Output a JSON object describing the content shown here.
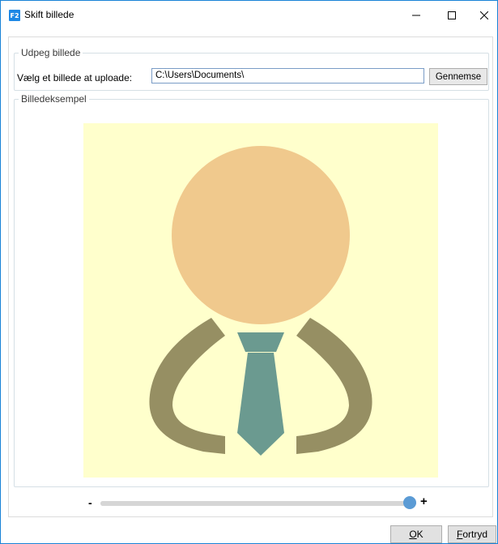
{
  "window": {
    "app_icon_text": "F2",
    "title": "Skift billede"
  },
  "select_group": {
    "legend": "Udpeg billede",
    "upload_label": "Vælg et billede at uploade:",
    "path_value": "C:\\Users\\Documents\\",
    "browse_label": "Gennemse"
  },
  "preview_group": {
    "legend": "Billedeksempel",
    "image_icon": "person-with-tie-avatar",
    "colors": {
      "background": "#ffffcc",
      "head": "#f0c98d",
      "body": "#968f63",
      "tie": "#6b9a90"
    }
  },
  "zoom": {
    "minus_label": "-",
    "plus_label": "+",
    "value_fraction": 0.98
  },
  "buttons": {
    "ok_mnemonic": "O",
    "ok_rest": "K",
    "cancel_mnemonic": "F",
    "cancel_rest": "ortryd"
  }
}
